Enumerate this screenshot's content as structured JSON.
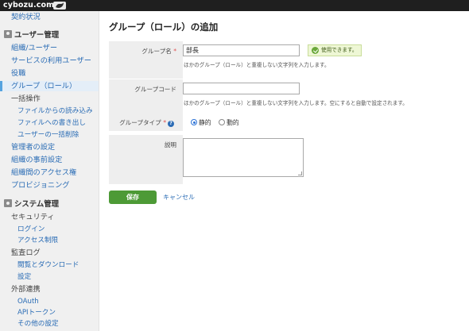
{
  "topbar": {
    "logo": "cybozu.com"
  },
  "sidebar": {
    "contract": "契約状況",
    "user_section": "ユーザー管理",
    "org_user": "組織/ユーザー",
    "service_users": "サービスの利用ユーザー",
    "roles": "役職",
    "groups": "グループ（ロール）",
    "bulk": "一括操作",
    "file_import": "ファイルからの読み込み",
    "file_export": "ファイルへの書き出し",
    "bulk_delete": "ユーザーの一括削除",
    "admin_settings": "管理者の設定",
    "pre_org": "組織の事前設定",
    "org_access": "組織間のアクセス権",
    "provisioning": "プロビジョニング",
    "system_section": "システム管理",
    "security": "セキュリティ",
    "login": "ログイン",
    "access_control": "アクセス制限",
    "audit_log": "監査ログ",
    "view_download": "閲覧とダウンロード",
    "settings": "設定",
    "external": "外部連携",
    "oauth": "OAuth",
    "api_token": "APIトークン",
    "other": "その他の設定"
  },
  "main": {
    "title": "グループ（ロール）の追加",
    "group_name": {
      "label": "グループ名",
      "required_mark": "*",
      "value": "部長",
      "hint": "ほかのグループ（ロール）と重複しない文字列を入力します。",
      "valid": "使用できます。"
    },
    "group_code": {
      "label": "グループコード",
      "value": "",
      "hint": "ほかのグループ（ロール）と重複しない文字列を入力します。空にすると自動で設定されます。"
    },
    "group_type": {
      "label": "グループタイプ",
      "required_mark": "*",
      "static": "静的",
      "dynamic": "動的",
      "selected": "静的"
    },
    "description": {
      "label": "説明",
      "value": ""
    },
    "save": "保存",
    "cancel": "キャンセル"
  }
}
